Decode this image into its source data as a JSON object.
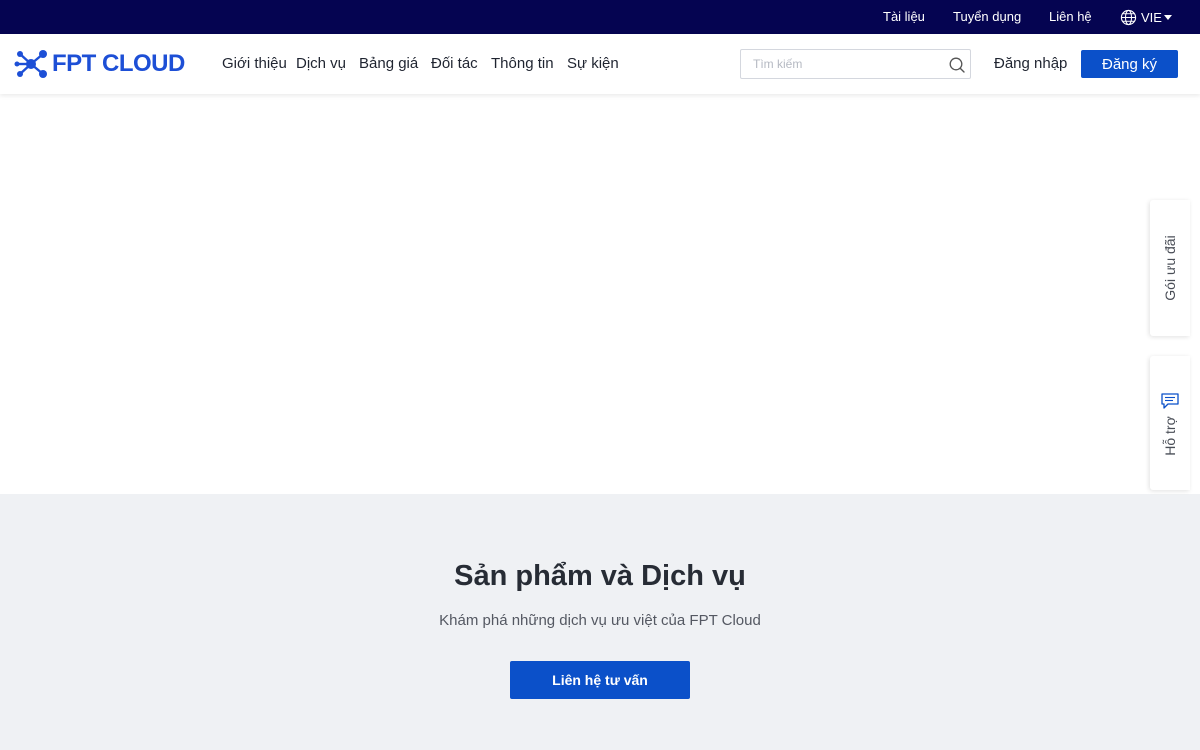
{
  "topbar": {
    "links": [
      "Tài liệu",
      "Tuyển dụng",
      "Liên hệ"
    ],
    "language": "VIE"
  },
  "header": {
    "logo_text": "FPT CLOUD",
    "nav": [
      "Giới thiệu",
      "Dịch vụ",
      "Bảng giá",
      "Đối tác",
      "Thông tin",
      "Sự kiện"
    ],
    "search_placeholder": "Tìm kiếm",
    "login_label": "Đăng nhập",
    "signup_label": "Đăng ký"
  },
  "products": {
    "title": "Sản phẩm và Dịch vụ",
    "subtitle": "Khám phá những dịch vụ ưu việt của FPT Cloud",
    "cta_label": "Liên hệ tư vấn"
  },
  "side_tabs": {
    "offer": "Gói ưu đãi",
    "support": "Hỗ trợ"
  },
  "colors": {
    "topbar": "#050451",
    "brand_blue": "#0b50c9",
    "logo_blue": "#1d4fd6",
    "section_bg": "#eff1f4"
  },
  "icons": [
    "globe-icon",
    "search-icon",
    "chat-icon",
    "logo-network-icon"
  ]
}
